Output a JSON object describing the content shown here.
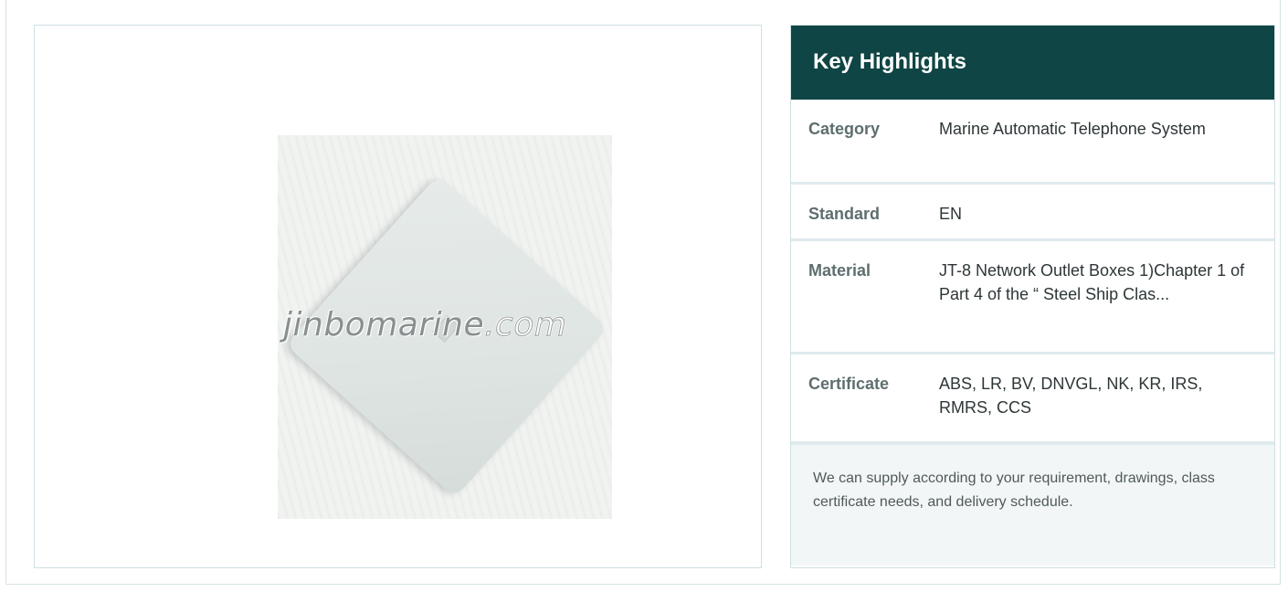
{
  "product_image": {
    "watermark_name": "jinbomarine",
    "watermark_suffix": ".com"
  },
  "key_highlights": {
    "title": "Key Highlights",
    "rows": [
      {
        "label": "Category",
        "value": "Marine Automatic Telephone System"
      },
      {
        "label": "Standard",
        "value": "EN"
      },
      {
        "label": "Material",
        "value": "JT-8 Network Outlet Boxes 1)Chapter 1 of Part 4 of the “ Steel Ship Clas..."
      },
      {
        "label": "Certificate",
        "value": "ABS, LR, BV, DNVGL, NK, KR, IRS, RMRS, CCS"
      }
    ],
    "note": "We can supply according to your requirement, drawings, class certificate needs, and delivery schedule."
  },
  "colors": {
    "header_bg": "#0f4544",
    "border": "#cfe0e4",
    "note_bg": "#f3f6f7"
  }
}
